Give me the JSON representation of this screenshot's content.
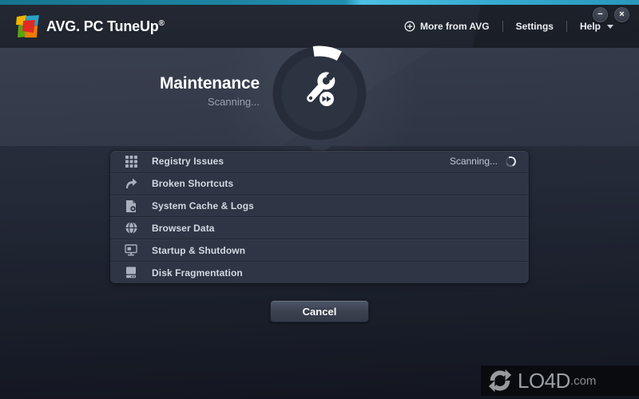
{
  "window": {
    "minimize_glyph": "−",
    "close_glyph": "×"
  },
  "header": {
    "brand": "AVG.",
    "product": "PC TuneUp",
    "registered_mark": "®"
  },
  "nav": {
    "more_from_avg": "More from AVG",
    "settings": "Settings",
    "help": "Help"
  },
  "main": {
    "title": "Maintenance",
    "subtitle": "Scanning..."
  },
  "panel": {
    "items": [
      {
        "label": "Registry Issues",
        "icon": "registry-grid-icon",
        "status": "Scanning..."
      },
      {
        "label": "Broken Shortcuts",
        "icon": "broken-shortcut-arrow-icon"
      },
      {
        "label": "System Cache & Logs",
        "icon": "cache-logs-document-icon"
      },
      {
        "label": "Browser Data",
        "icon": "browser-globe-icon"
      },
      {
        "label": "Startup & Shutdown",
        "icon": "startup-monitor-icon"
      },
      {
        "label": "Disk Fragmentation",
        "icon": "disk-drive-icon"
      }
    ]
  },
  "actions": {
    "cancel_label": "Cancel"
  },
  "watermark": {
    "name": "LO4D",
    "suffix": ".com"
  },
  "colors": {
    "accent_teal": "#2fa9cf",
    "header_bg": "#20252f",
    "main_bg_top": "#353c4c",
    "main_bg_bottom": "#151924",
    "panel_bg": "#2e3545",
    "text_primary": "#ffffff",
    "text_secondary": "#9aa2ae",
    "row_label": "#d3d9e2"
  }
}
